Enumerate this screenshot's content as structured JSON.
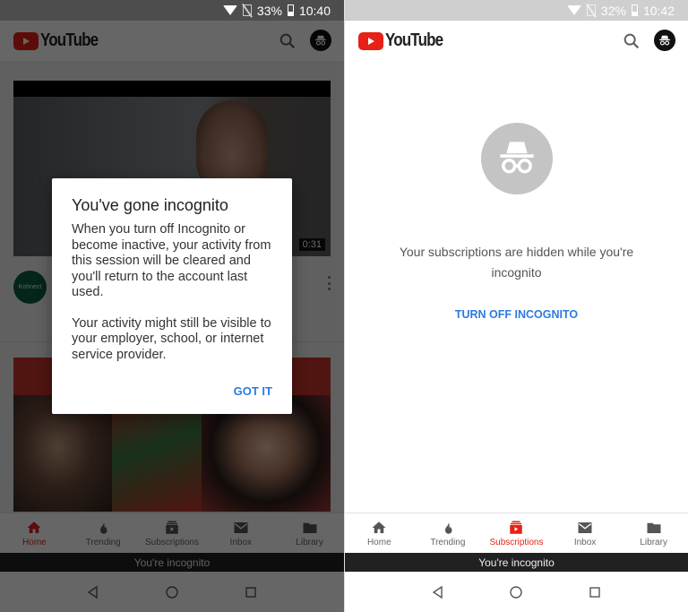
{
  "left_screen": {
    "status": {
      "battery": "33%",
      "time": "10:40"
    },
    "app_title": "YouTube",
    "feed": {
      "video1": {
        "duration": "0:31",
        "channel_avatar_text": "Kohnect"
      }
    },
    "dialog": {
      "title": "You've gone incognito",
      "paragraph1": "When you turn off Incognito or become inactive, your activity from this session will be cleared and you'll return to the account last used.",
      "paragraph2": "Your activity might still be visible to your employer, school, or internet service provider.",
      "confirm_label": "GOT IT"
    },
    "bottom_nav": [
      {
        "label": "Home",
        "icon": "home-icon",
        "active": true
      },
      {
        "label": "Trending",
        "icon": "trending-icon",
        "active": false
      },
      {
        "label": "Subscriptions",
        "icon": "subscriptions-icon",
        "active": false
      },
      {
        "label": "Inbox",
        "icon": "inbox-icon",
        "active": false
      },
      {
        "label": "Library",
        "icon": "library-icon",
        "active": false
      }
    ],
    "incognito_banner": "You're incognito"
  },
  "right_screen": {
    "status": {
      "battery": "32%",
      "time": "10:42"
    },
    "app_title": "YouTube",
    "empty_state": {
      "message": "Your subscriptions are hidden while you're incognito",
      "action_label": "TURN OFF INCOGNITO"
    },
    "bottom_nav": [
      {
        "label": "Home",
        "icon": "home-icon",
        "active": false
      },
      {
        "label": "Trending",
        "icon": "trending-icon",
        "active": false
      },
      {
        "label": "Subscriptions",
        "icon": "subscriptions-icon",
        "active": true
      },
      {
        "label": "Inbox",
        "icon": "inbox-icon",
        "active": false
      },
      {
        "label": "Library",
        "icon": "library-icon",
        "active": false
      }
    ],
    "incognito_banner": "You're incognito"
  },
  "colors": {
    "brand_red": "#e62117",
    "link_blue": "#2d7be0",
    "incognito_banner_bg": "#212121"
  }
}
